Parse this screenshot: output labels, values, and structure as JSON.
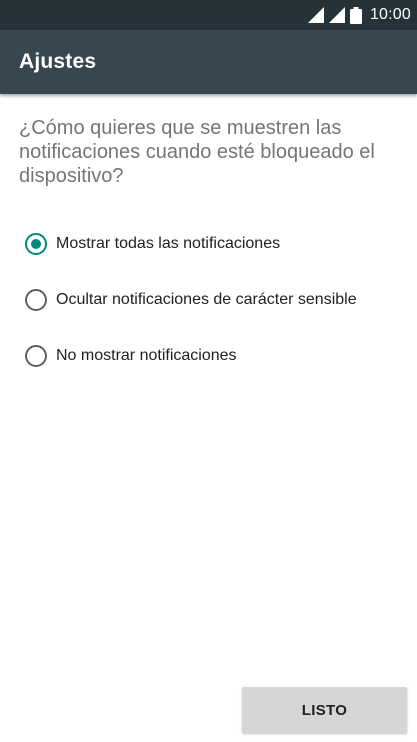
{
  "status_bar": {
    "time": "10:00",
    "icons": [
      "signal-strength-icon",
      "cellular-signal-icon",
      "battery-icon"
    ]
  },
  "app_bar": {
    "title": "Ajustes"
  },
  "question": "¿Cómo quieres que se muestren las notificaciones cuando esté bloqueado el dispositivo?",
  "options": [
    {
      "label": "Mostrar todas las notificaciones",
      "selected": true
    },
    {
      "label": "Ocultar notificaciones de carácter sensible",
      "selected": false
    },
    {
      "label": "No mostrar notificaciones",
      "selected": false
    }
  ],
  "done_button": {
    "label": "LISTO"
  },
  "colors": {
    "status_bar": "#263238",
    "app_bar": "#37474f",
    "accent": "#00897b",
    "button_bg": "#d6d6d6"
  }
}
